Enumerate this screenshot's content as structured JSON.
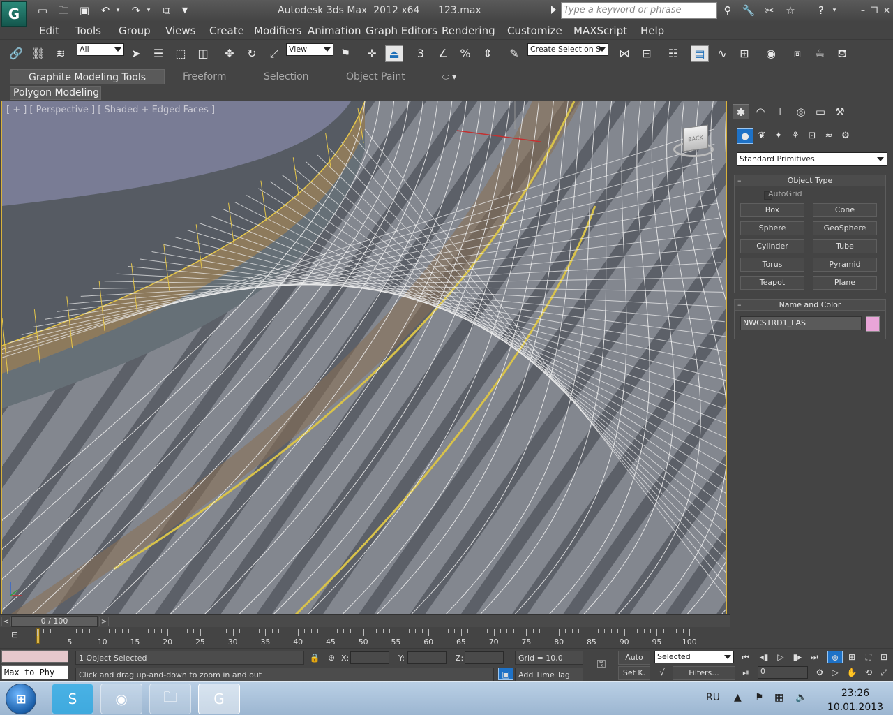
{
  "window": {
    "title": "Autodesk 3ds Max  2012 x64      123.max",
    "search_placeholder": "Type a keyword or phrase",
    "app_icon": "3ds-max-logo-icon",
    "quick_access": [
      "new-file-icon",
      "open-file-icon",
      "save-icon",
      "undo-icon",
      "redo-icon",
      "project-folder-icon"
    ],
    "title_icons": [
      "binoculars-icon",
      "wrench-icon",
      "satellite-icon",
      "star-icon",
      "help-icon"
    ]
  },
  "menu": {
    "items": [
      "Edit",
      "Tools",
      "Group",
      "Views",
      "Create",
      "Modifiers",
      "Animation",
      "Graph Editors",
      "Rendering",
      "Customize",
      "MAXScript",
      "Help"
    ]
  },
  "toolbar": {
    "selection_filter": "All",
    "reference_coord": "View",
    "named_selection": "Create Selection S",
    "snap_angle_label": "3",
    "percent_label": "%"
  },
  "ribbon": {
    "tabs": [
      "Graphite Modeling Tools",
      "Freeform",
      "Selection",
      "Object Paint"
    ],
    "active_tab": "Graphite Modeling Tools",
    "panel": "Polygon Modeling"
  },
  "viewport": {
    "label": "[ + ] [ Perspective ] [ Shaded + Edged Faces ]",
    "viewcube_label": "BACK",
    "border_color": "#d8b23c"
  },
  "command_panel": {
    "tabs": [
      "create-tab-icon",
      "modify-tab-icon",
      "hierarchy-tab-icon",
      "motion-tab-icon",
      "display-tab-icon",
      "utilities-tab-icon"
    ],
    "subtabs": [
      "geometry-icon",
      "shapes-icon",
      "lights-icon",
      "cameras-icon",
      "helpers-icon",
      "space-warps-icon",
      "systems-icon"
    ],
    "category": "Standard Primitives",
    "object_type": {
      "title": "Object Type",
      "autogrid": "AutoGrid",
      "buttons": [
        "Box",
        "Cone",
        "Sphere",
        "GeoSphere",
        "Cylinder",
        "Tube",
        "Torus",
        "Pyramid",
        "Teapot",
        "Plane"
      ]
    },
    "name_and_color": {
      "title": "Name and Color",
      "name": "NWCSTRD1_LAS",
      "color": "#e9a5d8"
    }
  },
  "timeslider": {
    "position": "0 / 100",
    "prev": "<",
    "next": ">"
  },
  "trackbar": {
    "ticks": [
      "5",
      "10",
      "15",
      "20",
      "25",
      "30",
      "35",
      "40",
      "45",
      "50",
      "55",
      "60",
      "65",
      "70",
      "75",
      "80",
      "85",
      "90",
      "95",
      "100"
    ]
  },
  "status": {
    "maxscript_text": "Max to Phy",
    "selection_info": "1 Object Selected",
    "prompt": "Click and drag up-and-down to zoom in and out",
    "x_label": "X:",
    "y_label": "Y:",
    "z_label": "Z:",
    "grid": "Grid = 10,0",
    "add_time_tag": "Add Time Tag",
    "auto_key": "Auto",
    "set_key": "Set K.",
    "key_filter": "Selected",
    "filters": "Filters...",
    "current_frame": "0"
  },
  "taskbar": {
    "apps": [
      "skype-icon",
      "chrome-icon",
      "explorer-folder-icon",
      "3ds-max-taskbar-icon"
    ],
    "language": "RU",
    "time": "23:26",
    "date": "10.01.2013"
  }
}
